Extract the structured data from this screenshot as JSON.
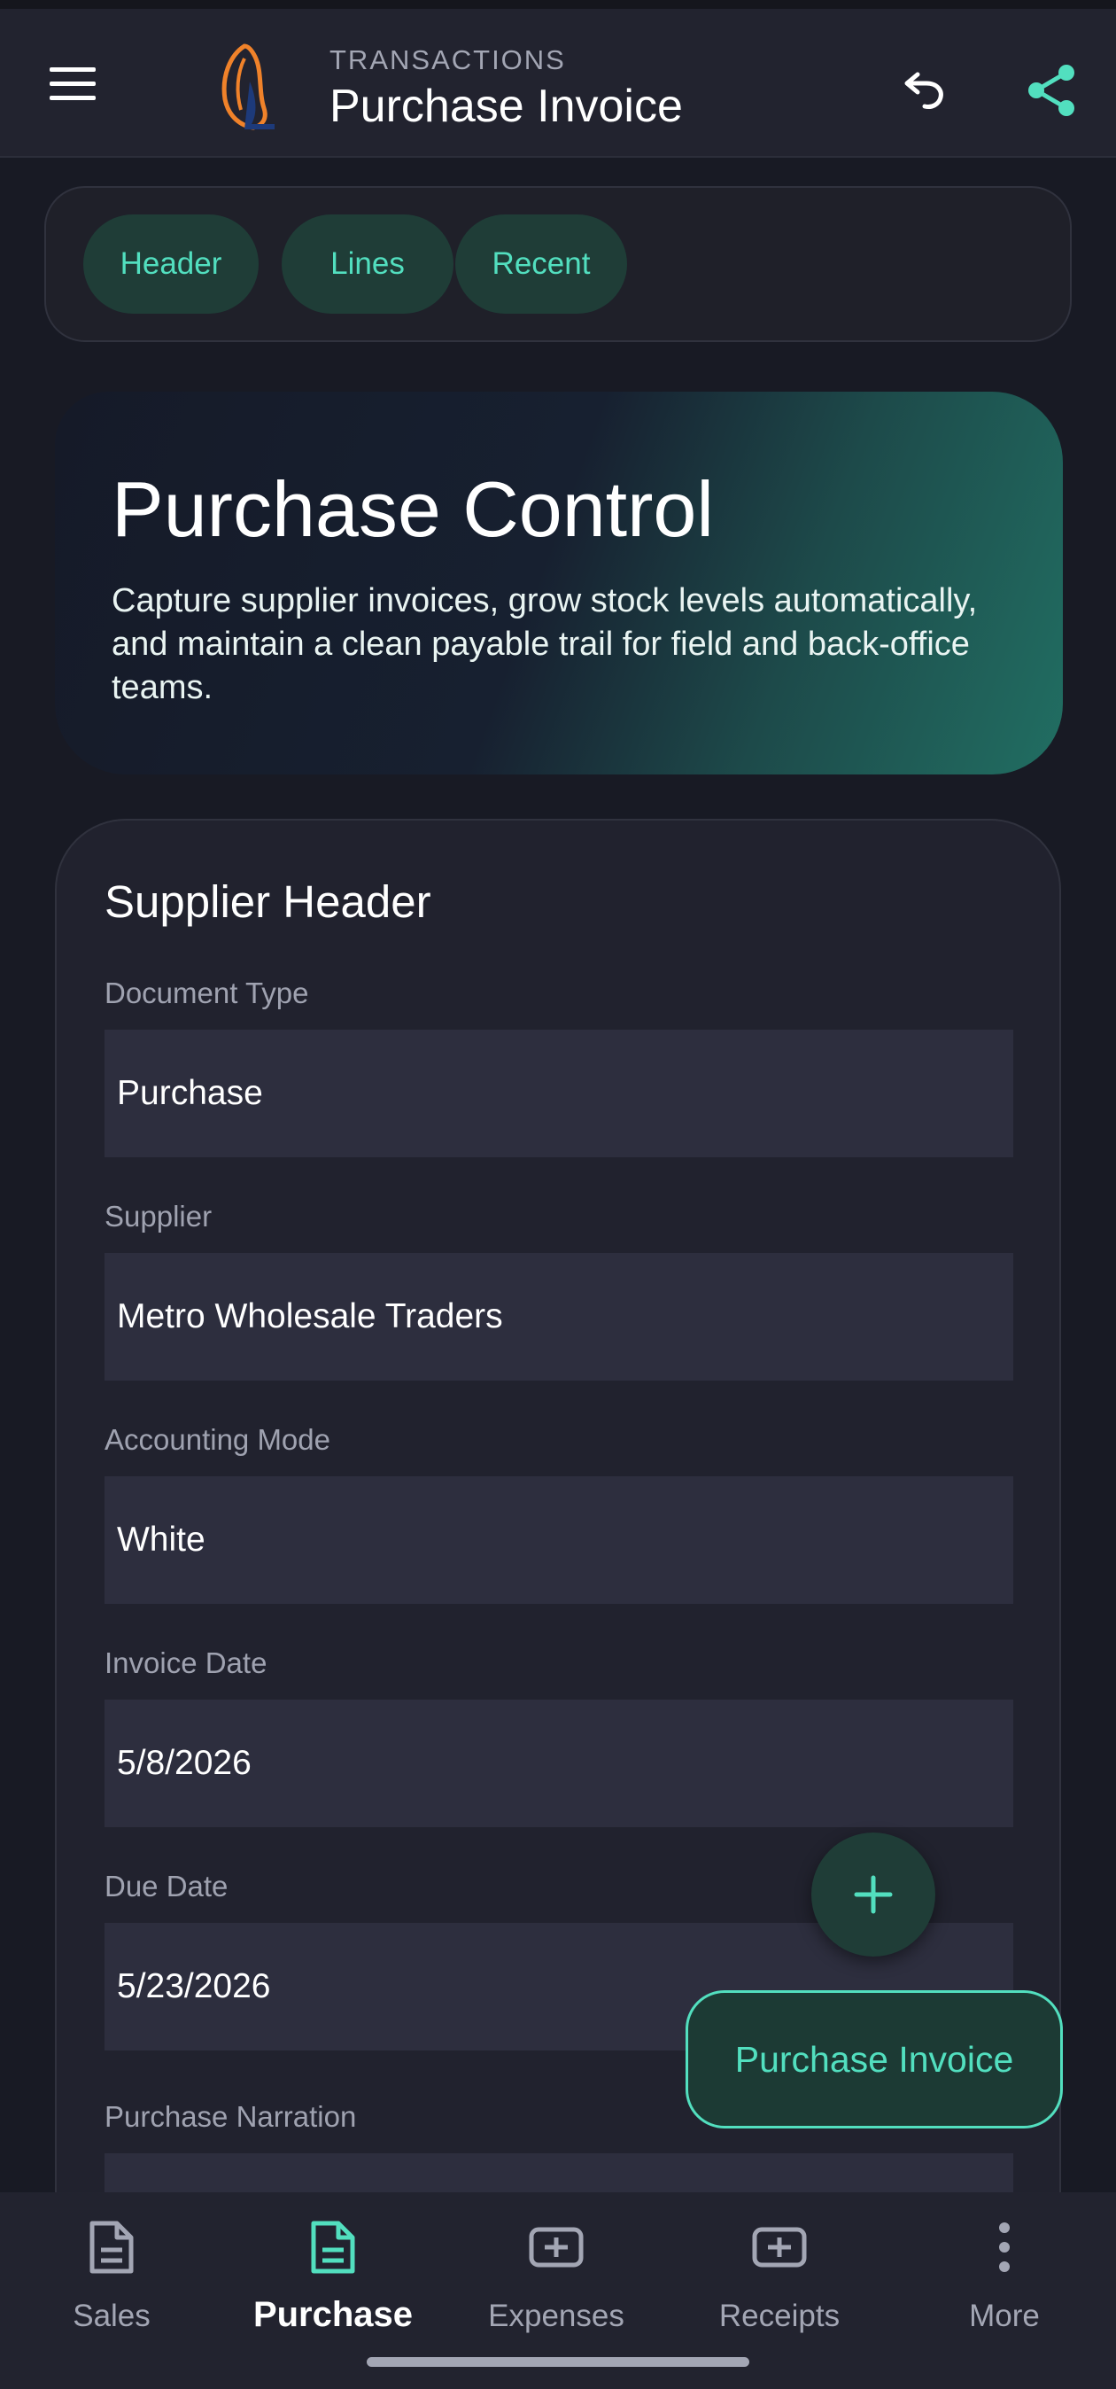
{
  "appbar": {
    "overline": "TRANSACTIONS",
    "title": "Purchase Invoice",
    "icons": {
      "menu": "hamburger-menu-icon",
      "logo": "shell-logo",
      "undo": "undo-icon",
      "share": "share-icon"
    }
  },
  "chips": [
    {
      "label": "Header"
    },
    {
      "label": "Lines"
    },
    {
      "label": "Recent"
    }
  ],
  "hero": {
    "title": "Purchase Control",
    "subtitle": "Capture supplier invoices, grow stock levels automatically, and maintain a clean payable trail for field and back-office teams."
  },
  "form": {
    "title": "Supplier Header",
    "fields": [
      {
        "label": "Document Type",
        "value": "Purchase"
      },
      {
        "label": "Supplier",
        "value": "Metro Wholesale Traders"
      },
      {
        "label": "Accounting Mode",
        "value": "White"
      },
      {
        "label": "Invoice Date",
        "value": "5/8/2026"
      },
      {
        "label": "Due Date",
        "value": "5/23/2026"
      },
      {
        "label": "Purchase Narration",
        "value": ""
      }
    ]
  },
  "fab": {
    "icon": "plus-icon"
  },
  "extended_button": {
    "label": "Purchase Invoice"
  },
  "bottom_nav": {
    "active": "Purchase",
    "items": [
      {
        "label": "Sales",
        "icon": "document-icon"
      },
      {
        "label": "Purchase",
        "icon": "document-icon"
      },
      {
        "label": "Expenses",
        "icon": "add-box-icon"
      },
      {
        "label": "Receipts",
        "icon": "add-box-icon"
      },
      {
        "label": "More",
        "icon": "more-vert-icon"
      }
    ]
  },
  "colors": {
    "accent": "#52dfbf",
    "background": "#181a24",
    "surface": "#21222e",
    "input": "#2d2e3e",
    "chip": "#1f3d37",
    "logo_orange": "#f0822a",
    "logo_navy": "#1d3a7a"
  }
}
